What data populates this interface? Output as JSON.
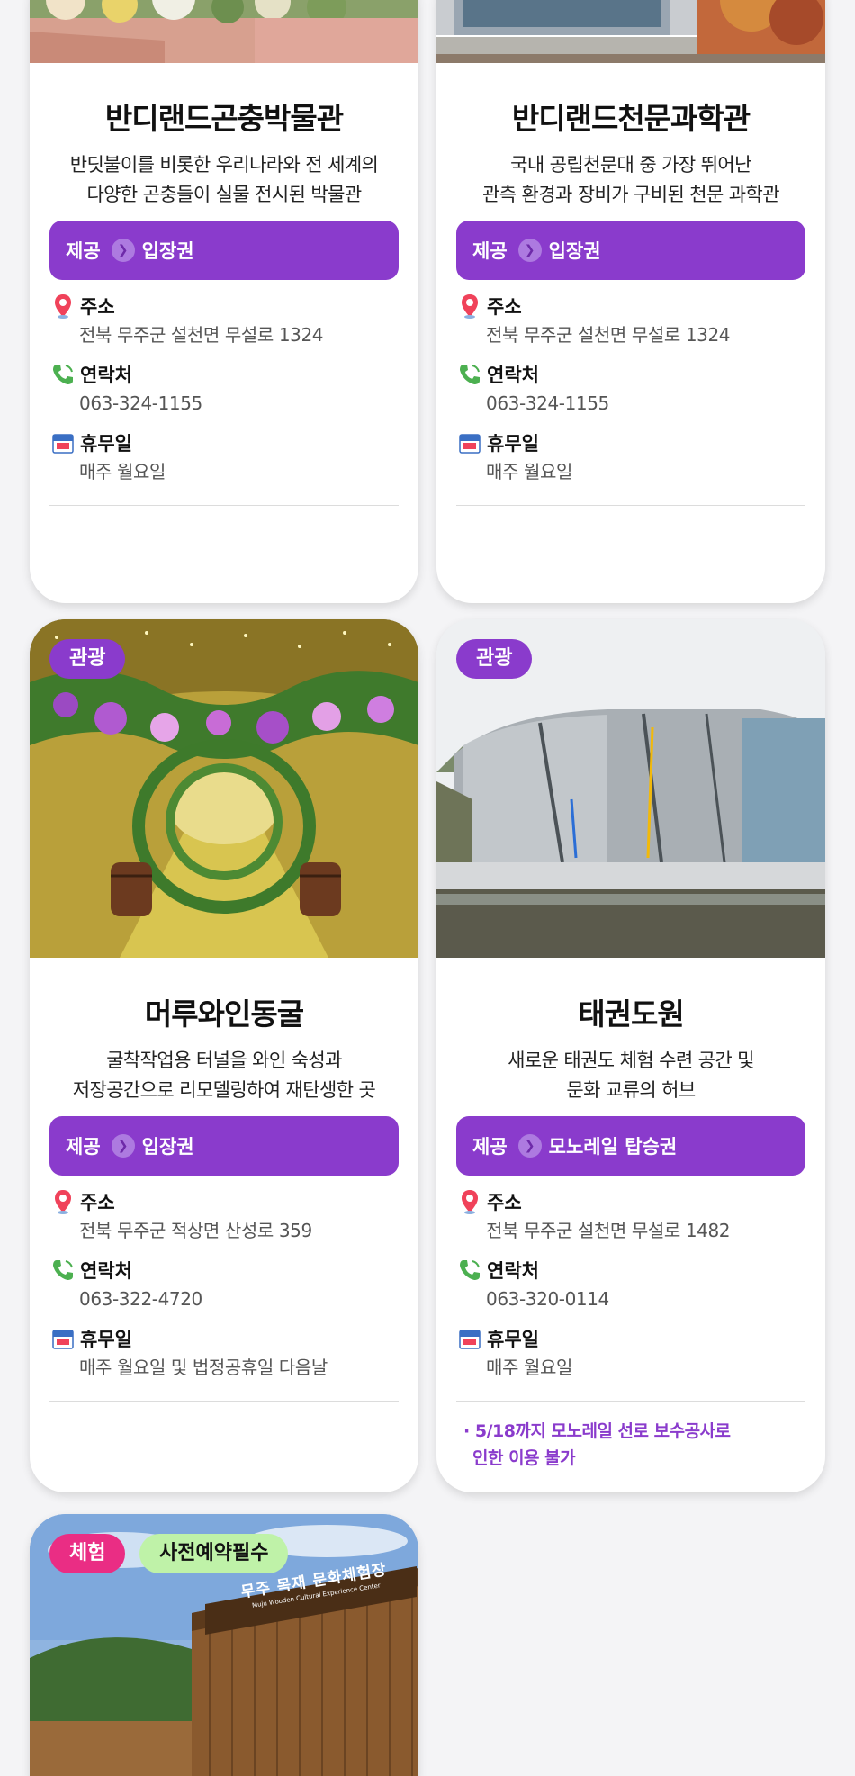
{
  "cards": [
    {
      "title": "반디랜드곤충박물관",
      "desc_line1": "반딧불이를 비롯한 우리나라와 전 세계의",
      "desc_line2": "다양한 곤충들이 실물 전시된 박물관",
      "offer_label": "제공",
      "offer_value": "입장권",
      "address_label": "주소",
      "address": "전북 무주군 설천면 무설로 1324",
      "contact_label": "연락처",
      "contact": "063-324-1155",
      "closed_label": "휴무일",
      "closed": "매주 월요일"
    },
    {
      "title": "반디랜드천문과학관",
      "desc_line1": "국내 공립천문대 중 가장 뛰어난",
      "desc_line2": "관측 환경과 장비가 구비된 천문 과학관",
      "offer_label": "제공",
      "offer_value": "입장권",
      "address_label": "주소",
      "address": "전북 무주군 설천면 무설로 1324",
      "contact_label": "연락처",
      "contact": "063-324-1155",
      "closed_label": "휴무일",
      "closed": "매주 월요일"
    },
    {
      "tag": "관광",
      "title": "머루와인동굴",
      "desc_line1": "굴착작업용 터널을 와인 숙성과",
      "desc_line2": "저장공간으로 리모델링하여 재탄생한 곳",
      "offer_label": "제공",
      "offer_value": "입장권",
      "address_label": "주소",
      "address": "전북 무주군 적상면 산성로 359",
      "contact_label": "연락처",
      "contact": "063-322-4720",
      "closed_label": "휴무일",
      "closed": "매주 월요일 및 법정공휴일 다음날"
    },
    {
      "tag": "관광",
      "title": "태권도원",
      "desc_line1": "새로운 태권도 체험 수련 공간 및",
      "desc_line2": "문화 교류의 허브",
      "offer_label": "제공",
      "offer_value": "모노레일 탑승권",
      "address_label": "주소",
      "address": "전북 무주군 설천면 무설로 1482",
      "contact_label": "연락처",
      "contact": "063-320-0114",
      "closed_label": "휴무일",
      "closed": "매주 월요일",
      "notice_line1": "· 5/18까지 모노레일 선로 보수공사로",
      "notice_line2": "인한 이용 불가"
    },
    {
      "tag": "체험",
      "tag2": "사전예약필수",
      "sign_text": "무주 목재 문화체험장",
      "sign_sub": "Muju Wooden Cultural Experience Center"
    }
  ],
  "colors": {
    "accent_purple": "#8a3bcc",
    "tag_pink": "#ea2d84",
    "tag_green": "#bff2a8",
    "notice": "#8a3bcc"
  },
  "icons": {
    "address": "map-pin-icon",
    "contact": "phone-icon",
    "closed": "calendar-icon",
    "offer_arrow": "chevron-right-icon"
  }
}
